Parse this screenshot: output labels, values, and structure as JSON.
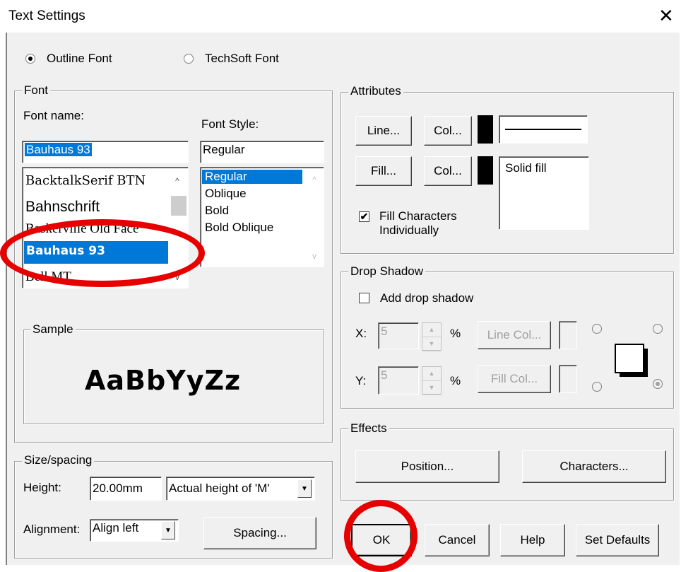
{
  "window": {
    "title": "Text Settings",
    "close_glyph": "✕"
  },
  "font_type": {
    "outline_label": "Outline Font",
    "techsoft_label": "TechSoft Font",
    "selected": "Outline Font"
  },
  "font": {
    "legend": "Font",
    "name_label": "Font name:",
    "name_value": "Bauhaus 93",
    "font_list": [
      "BacktalkSerif BTN",
      "Bahnschrift",
      "Baskerville Old Face",
      "Bauhaus 93",
      "Bell MT"
    ],
    "selected_font": "Bauhaus 93",
    "style_label": "Font Style:",
    "style_value": "Regular",
    "style_list": [
      "Regular",
      "Oblique",
      "Bold",
      "Bold Oblique"
    ],
    "selected_style": "Regular"
  },
  "sample": {
    "legend": "Sample",
    "text": "AaBbYyZz"
  },
  "size": {
    "legend": "Size/spacing",
    "height_label": "Height:",
    "height_value": "20.00mm",
    "height_mode": "Actual height of 'M'",
    "alignment_label": "Alignment:",
    "alignment_value": "Align left",
    "spacing_button": "Spacing..."
  },
  "attributes": {
    "legend": "Attributes",
    "line_button": "Line...",
    "col_button": "Col...",
    "fill_button": "Fill...",
    "fill_text": "Solid fill",
    "fill_chars_label": "Fill Characters Individually",
    "fill_chars_line1": "Fill Characters",
    "fill_chars_line2": "Individually",
    "fill_chars_checked": true,
    "swatch_color": "#000000"
  },
  "shadow": {
    "legend": "Drop Shadow",
    "add_label": "Add drop shadow",
    "add_checked": false,
    "x_label": "X:",
    "x_value": "5",
    "y_label": "Y:",
    "y_value": "5",
    "unit": "%",
    "line_col_button": "Line Col...",
    "fill_col_button": "Fill Col..."
  },
  "effects": {
    "legend": "Effects",
    "position_button": "Position...",
    "characters_button": "Characters..."
  },
  "footer": {
    "ok": "OK",
    "cancel": "Cancel",
    "help": "Help",
    "defaults": "Set Defaults"
  },
  "colors": {
    "selection": "#0078d7",
    "annotation": "#e60000",
    "dialog_bg": "#f0f0f0"
  },
  "icons": {
    "up": "▲",
    "down": "▼",
    "scroll_up": "^",
    "scroll_down": "v",
    "check": "✔"
  }
}
